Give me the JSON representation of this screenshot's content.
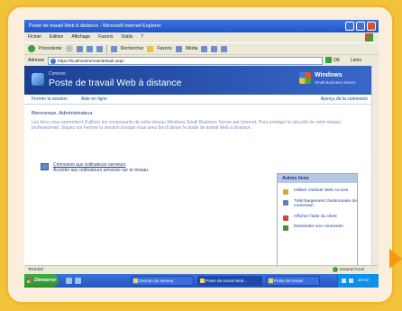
{
  "window": {
    "title": "Poste de travail Web à distance - Microsoft Internet Explorer"
  },
  "menu": [
    "Fichier",
    "Edition",
    "Affichage",
    "Favoris",
    "Outils",
    "?"
  ],
  "toolbar": {
    "back_label": "Précédente",
    "search_label": "Rechercher",
    "favorites_label": "Favoris",
    "media_label": "Média"
  },
  "address": {
    "label": "Adresse",
    "url": "https://localhost/remote/default.aspx",
    "go_label": "OK",
    "links_label": "Liens"
  },
  "header": {
    "organization": "Contoso",
    "title": "Poste de travail Web à distance",
    "brand_line1": "Windows",
    "brand_line2": "Small Business Server"
  },
  "links": {
    "left1": "Fermer la session",
    "left2": "Aide en ligne",
    "right": "Aperçu de la connexion"
  },
  "content": {
    "welcome": "Bienvenue, Administrateur.",
    "intro": "Les liens vous permettent d'utiliser les composants de votre réseau Windows Small Business Server par Internet. Pour protéger la sécurité de votre réseau professionnel, cliquez sur Fermer la session lorsque vous avez fini d'utiliser le poste de travail Web à distance.",
    "connect_link": "Connexion aux ordinateurs serveurs",
    "connect_desc": "Accéder aux ordinateurs serveurs sur le réseau."
  },
  "panel": {
    "title": "Autres liens",
    "items": [
      {
        "label": "Utiliser Outlook Web Access",
        "icon": "outlook-icon",
        "color": "#e0a53a"
      },
      {
        "label": "Téléchargement Gestionnaire de connexion",
        "icon": "download-icon",
        "color": "#5a7fc7"
      },
      {
        "label": "Afficher l'aide du client",
        "icon": "help-icon",
        "color": "#c94a3a"
      },
      {
        "label": "Demander une connexion",
        "icon": "network-icon",
        "color": "#4f8f3f"
      }
    ]
  },
  "status": {
    "left": "Terminé",
    "zone": "Intranet local"
  },
  "taskbar": {
    "start_label": "Démarrer",
    "tasks": [
      "Gestion du serveur",
      "Poste de travail Web...",
      "Poste de travail"
    ],
    "clock": "10:42"
  }
}
